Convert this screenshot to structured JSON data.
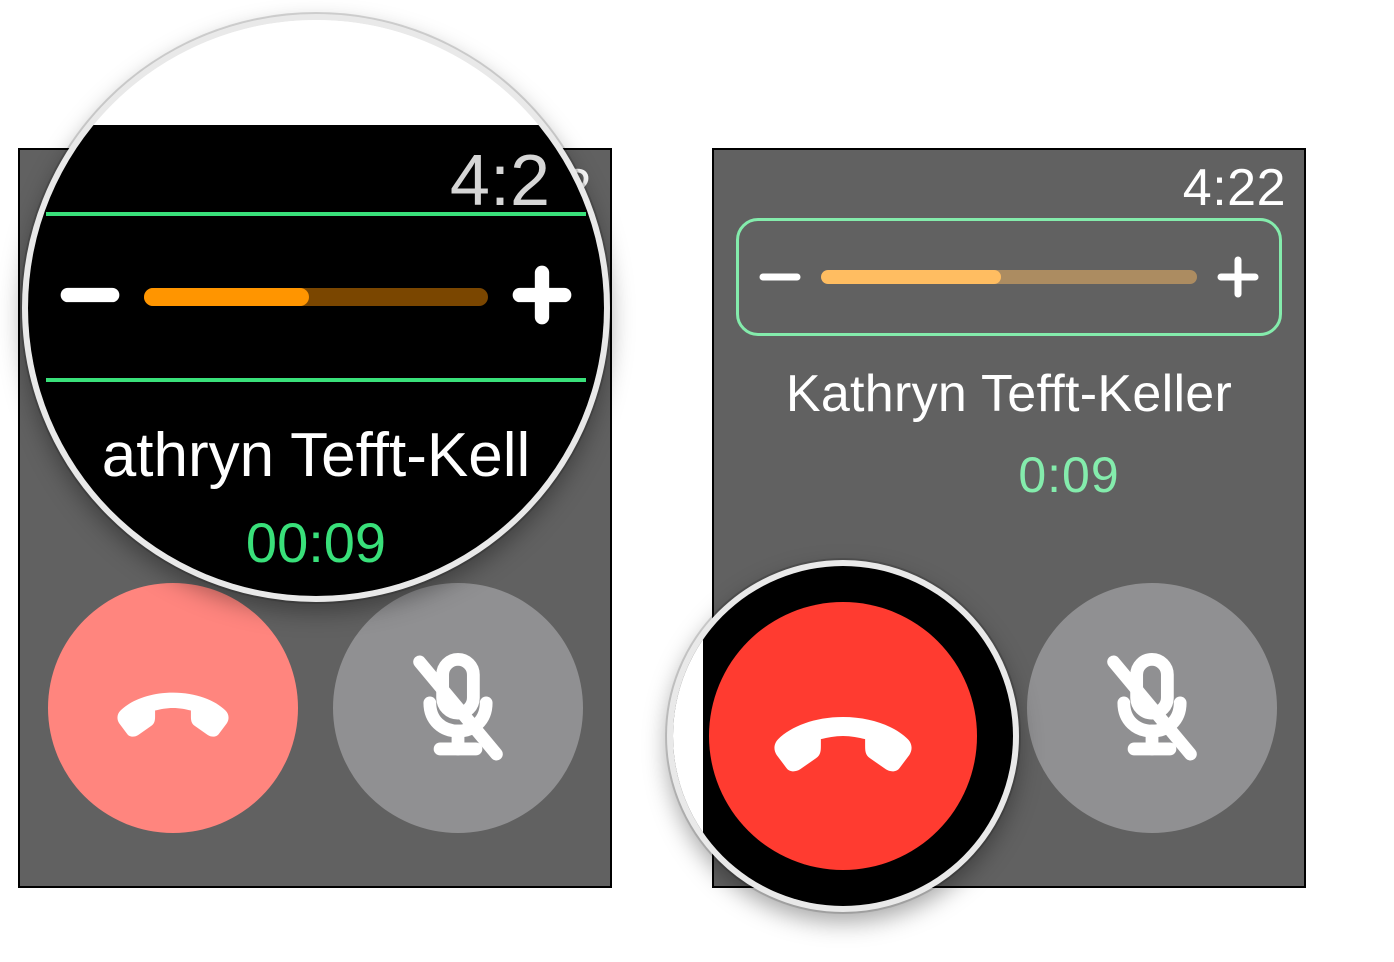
{
  "time": "4:22",
  "caller_name": "Kathryn Tefft-Keller",
  "call_duration": "00:09",
  "volume": {
    "level_percent": 48
  },
  "icons": {
    "volume_down": "minus-icon",
    "volume_up": "plus-icon",
    "end_call": "phone-hangup-icon",
    "mute": "mic-muted-icon"
  },
  "colors": {
    "accent_green": "#39e07a",
    "volume_active": "#ff9500",
    "end_call_red": "#ff3b30"
  },
  "zoom": {
    "lens1_time_partial": "4:2",
    "lens1_caller_partial": "athryn Tefft-Kell",
    "lens1_duration": "00:09"
  },
  "screens": {
    "left": {
      "highlight": "volume"
    },
    "right": {
      "highlight": "end_call",
      "duration_partial": "0:09"
    }
  }
}
